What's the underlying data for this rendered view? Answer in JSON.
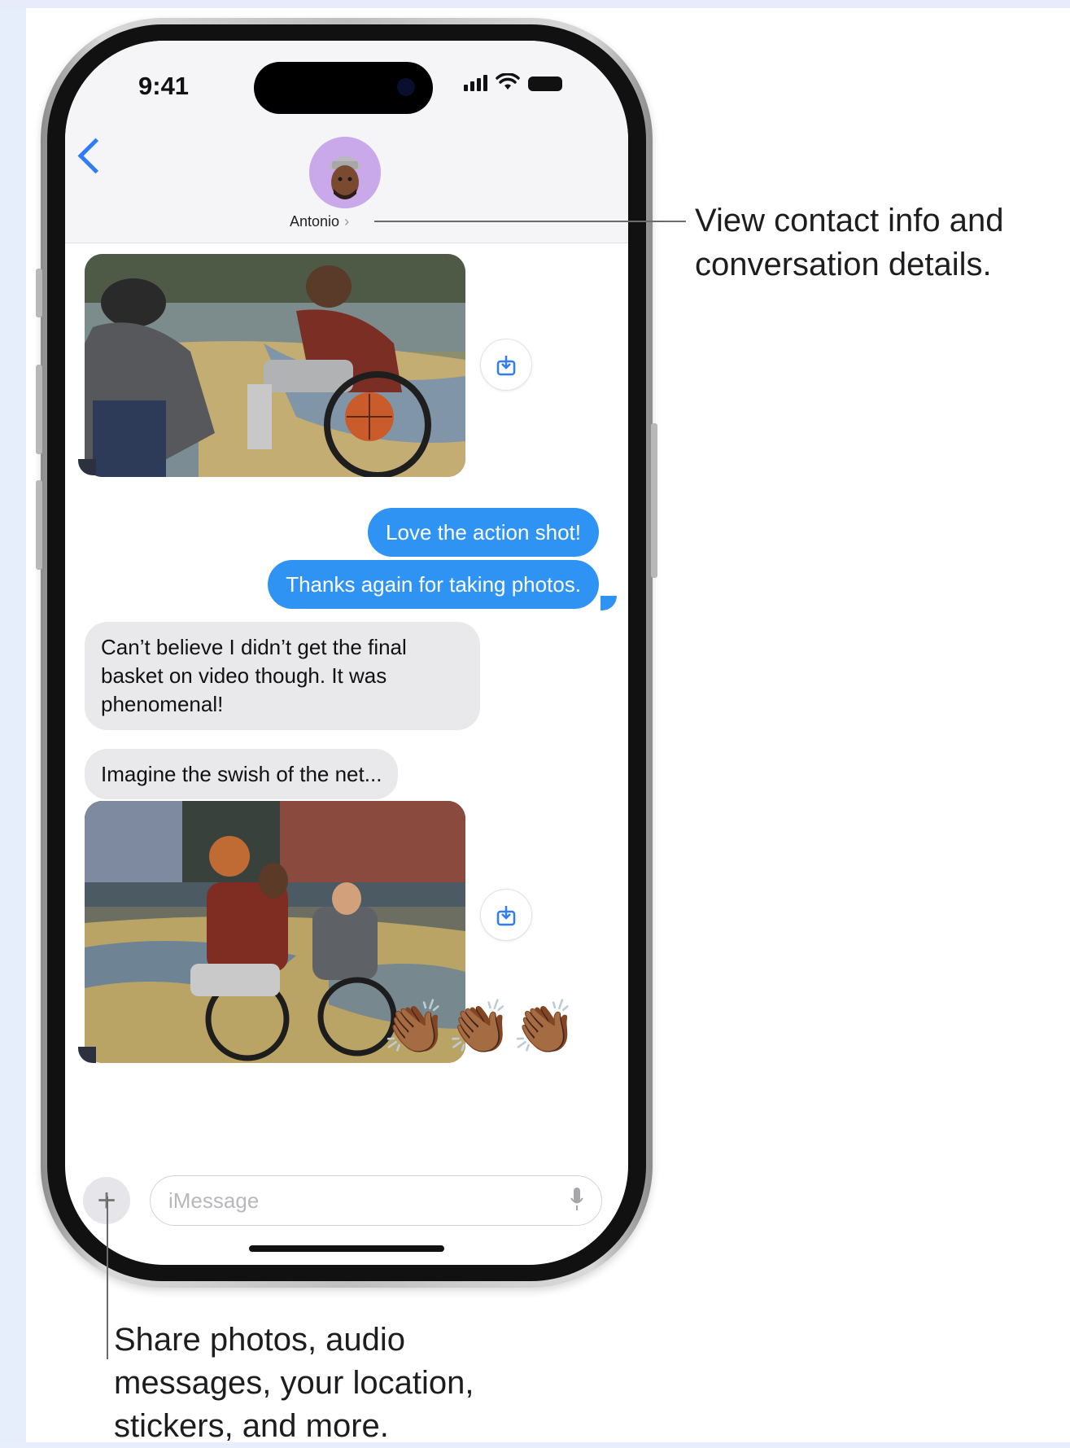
{
  "status_bar": {
    "time": "9:41"
  },
  "header": {
    "contact_name": "Antonio",
    "contact_chevron": "›"
  },
  "messages": {
    "outgoing": [
      "Love the action shot!",
      "Thanks again for taking photos."
    ],
    "incoming": [
      "Can’t believe I didn’t get the final basket on video though. It was phenomenal!",
      "Imagine the swish of the net..."
    ],
    "emoji": "👏🏾👏🏾👏🏾"
  },
  "composer": {
    "placeholder": "iMessage",
    "plus_label": "+"
  },
  "callouts": {
    "contact_info": "View contact info and\nconversation details.",
    "share": "Share photos, audio\nmessages, your location,\nstickers, and more."
  },
  "colors": {
    "outgoing_bubble": "#2f93f4",
    "incoming_bubble": "#e9e9eb",
    "accent": "#2f7cf6",
    "avatar_bg": "#c9a9e9"
  },
  "icons": [
    "back-chevron-icon",
    "signal-icon",
    "wifi-icon",
    "battery-icon",
    "share-icon",
    "plus-icon",
    "microphone-icon"
  ]
}
